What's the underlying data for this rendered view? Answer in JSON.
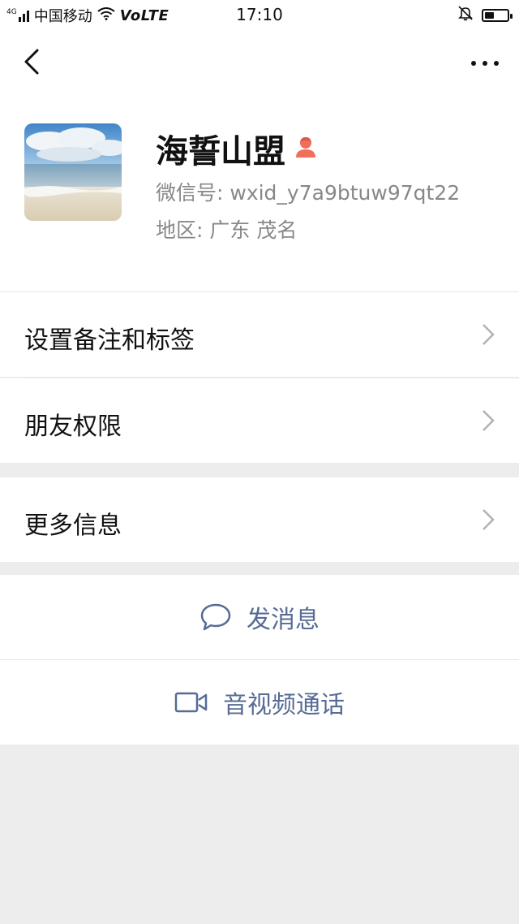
{
  "status_bar": {
    "network": "4G",
    "carrier": "中国移动",
    "volte": "VoLTE",
    "time": "17:10"
  },
  "profile": {
    "name": "海誓山盟",
    "wechat_id": "微信号: wxid_y7a9btuw97qt22",
    "region": "地区: 广东  茂名",
    "gender_icon": "female-icon"
  },
  "menu": {
    "remark_and_tags": "设置备注和标签",
    "friend_permissions": "朋友权限",
    "more_info": "更多信息"
  },
  "actions": {
    "send_message": "发消息",
    "video_call": "音视频通话"
  },
  "colors": {
    "link_blue": "#576b95",
    "background": "#ededed",
    "gender_icon": "#f06f5b"
  }
}
